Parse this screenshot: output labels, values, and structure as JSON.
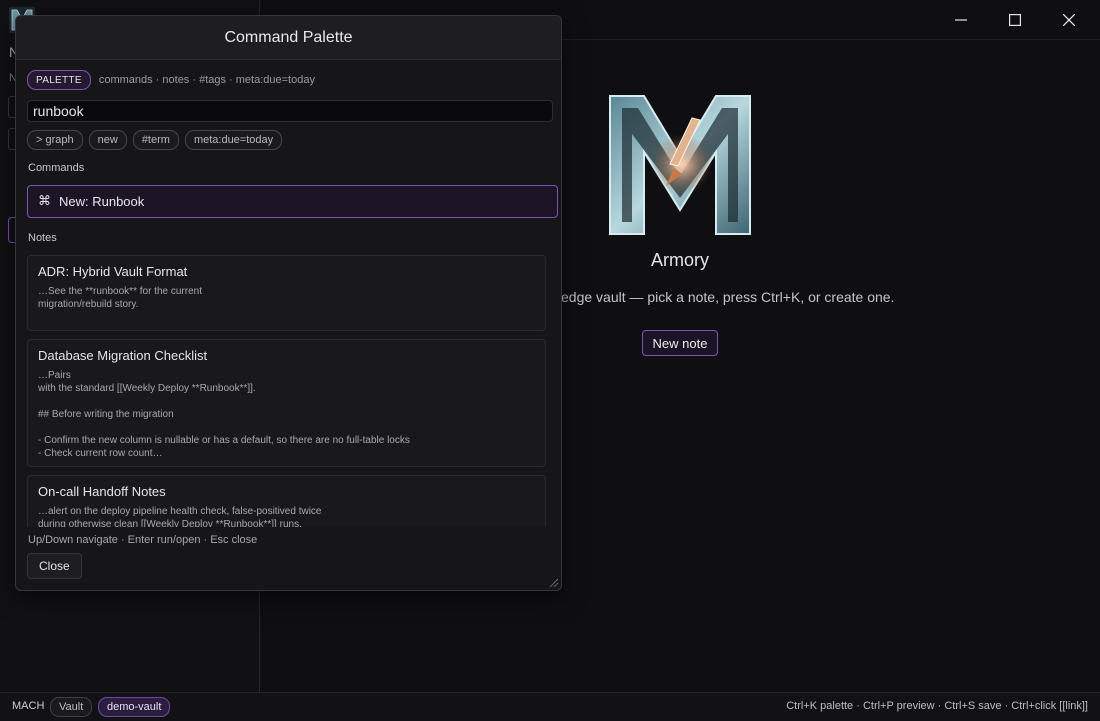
{
  "palette": {
    "title": "Command Palette",
    "mode_badge": "PALETTE",
    "mode_hint": "commands · notes · #tags · meta:due=today",
    "search_value": "runbook",
    "chips": [
      "> graph",
      "new",
      "#term",
      "meta:due=today"
    ],
    "commands_label": "Commands",
    "commands": [
      {
        "icon": "command-icon",
        "glyph": "⌘",
        "label": "New: Runbook"
      }
    ],
    "notes_label": "Notes",
    "notes": [
      {
        "title": "ADR: Hybrid Vault Format",
        "snippet": "…See the **runbook** for the current\nmigration/rebuild story."
      },
      {
        "title": "Database Migration Checklist",
        "snippet": "…Pairs\nwith the standard [[Weekly Deploy **Runbook**]].\n\n## Before writing the migration\n\n- Confirm the new column is nullable or has a default, so there are no full-table locks\n- Check current row count…"
      },
      {
        "title": "On-call Handoff Notes",
        "snippet": "…alert on the deploy pipeline health check, false-positived twice\nduring otherwise clean [[Weekly Deploy **Runbook**]] runs."
      }
    ],
    "footer_hint": "Up/Down navigate · Enter run/open · Esc close",
    "close_label": "Close"
  },
  "hero": {
    "title": "Armory",
    "subtitle": "edge vault — pick a note, press Ctrl+K, or create one.",
    "new_note_label": "New note"
  },
  "sidebar_fragments": {
    "letter1": "N",
    "letter2": "N"
  },
  "statusbar": {
    "app": "MACH",
    "vault_label": "Vault",
    "vault_name": "demo-vault",
    "hints": "Ctrl+K palette · Ctrl+P preview · Ctrl+S save · Ctrl+click [[link]]"
  },
  "colors": {
    "accent": "#7a55b8",
    "background": "#0d0d10"
  }
}
